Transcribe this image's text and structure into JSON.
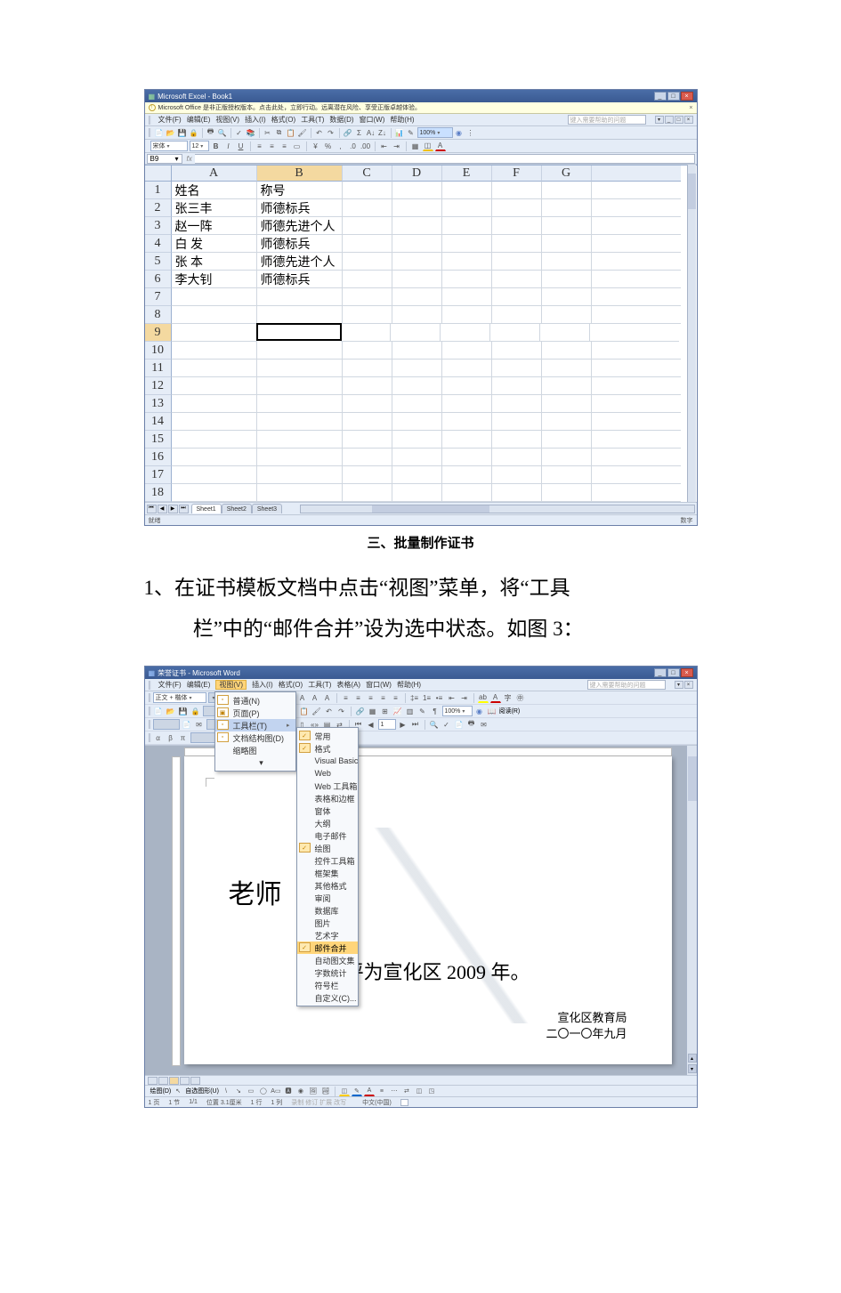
{
  "excel": {
    "title": "Microsoft Excel - Book1",
    "infobar": "Microsoft Office 是非正版授权版本。点击此处，立即行动。远离潜在风险、享受正版卓越体验。",
    "menus": [
      "文件(F)",
      "编辑(E)",
      "视图(V)",
      "插入(I)",
      "格式(O)",
      "工具(T)",
      "数据(D)",
      "窗口(W)",
      "帮助(H)"
    ],
    "help_placeholder": "键入需要帮助的问题",
    "font_name": "宋体",
    "font_size": "12",
    "namebox": "B9",
    "columns": [
      "A",
      "B",
      "C",
      "D",
      "E",
      "F",
      "G"
    ],
    "rows": [
      "1",
      "2",
      "3",
      "4",
      "5",
      "6",
      "7",
      "8",
      "9",
      "10",
      "11",
      "12",
      "13",
      "14",
      "15",
      "16",
      "17",
      "18"
    ],
    "data": [
      [
        "姓名",
        "称号",
        "",
        "",
        "",
        "",
        "",
        ""
      ],
      [
        "张三丰",
        "师德标兵",
        "",
        "",
        "",
        "",
        "",
        ""
      ],
      [
        "赵一阵",
        "师德先进个人",
        "",
        "",
        "",
        "",
        "",
        ""
      ],
      [
        "白  发",
        "师德标兵",
        "",
        "",
        "",
        "",
        "",
        ""
      ],
      [
        "张  本",
        "师德先进个人",
        "",
        "",
        "",
        "",
        "",
        ""
      ],
      [
        "李大钊",
        "师德标兵",
        "",
        "",
        "",
        "",
        "",
        ""
      ],
      [
        "",
        "",
        "",
        "",
        "",
        "",
        "",
        ""
      ],
      [
        "",
        "",
        "",
        "",
        "",
        "",
        "",
        ""
      ],
      [
        "",
        "",
        "",
        "",
        "",
        "",
        "",
        ""
      ],
      [
        "",
        "",
        "",
        "",
        "",
        "",
        "",
        ""
      ],
      [
        "",
        "",
        "",
        "",
        "",
        "",
        "",
        ""
      ],
      [
        "",
        "",
        "",
        "",
        "",
        "",
        "",
        ""
      ],
      [
        "",
        "",
        "",
        "",
        "",
        "",
        "",
        ""
      ],
      [
        "",
        "",
        "",
        "",
        "",
        "",
        "",
        ""
      ],
      [
        "",
        "",
        "",
        "",
        "",
        "",
        "",
        ""
      ],
      [
        "",
        "",
        "",
        "",
        "",
        "",
        "",
        ""
      ],
      [
        "",
        "",
        "",
        "",
        "",
        "",
        "",
        ""
      ],
      [
        "",
        "",
        "",
        "",
        "",
        "",
        "",
        ""
      ]
    ],
    "selected_cell": "B9",
    "tabs": [
      "Sheet1",
      "Sheet2",
      "Sheet3"
    ],
    "status_left": "就绪",
    "status_right": "数字"
  },
  "caption": "三、批量制作证书",
  "body": {
    "num": "1、",
    "line1": "在证书模板文档中点击“视图”菜单，将“工具",
    "line2": "栏”中的“邮件合并”设为选中状态。如图 3："
  },
  "word": {
    "title": " 荣誉证书  - Microsoft Word",
    "menus": [
      "文件(F)",
      "编辑(E)",
      "视图(V)",
      "插入(I)",
      "格式(O)",
      "工具(T)",
      "表格(A)",
      "窗口(W)",
      "帮助(H)"
    ],
    "open_menu": "视图(V)",
    "help_placeholder": "键入需要帮助的问题",
    "style_combo": "正文 + 楷体",
    "zoom": "100%",
    "submenu1": [
      {
        "label": "普通(N)",
        "icon": true
      },
      {
        "label": "页面(P)",
        "icon": true,
        "hl": true
      },
      {
        "label": "工具栏(T)",
        "icon": true,
        "arrow": true,
        "open": true
      },
      {
        "label": "文档结构图(D)",
        "icon": true
      },
      {
        "label": "缩略图"
      }
    ],
    "submenu_more": "▾",
    "submenu2": [
      {
        "label": "常用",
        "chk": true
      },
      {
        "label": "格式",
        "chk": true
      },
      {
        "label": "Visual Basic"
      },
      {
        "label": "Web"
      },
      {
        "label": "Web 工具箱"
      },
      {
        "label": "表格和边框"
      },
      {
        "label": "窗体"
      },
      {
        "label": "大纲"
      },
      {
        "label": "电子邮件"
      },
      {
        "label": "绘图",
        "chk": true
      },
      {
        "label": "控件工具箱"
      },
      {
        "label": "框架集"
      },
      {
        "label": "其他格式"
      },
      {
        "label": "审阅"
      },
      {
        "label": "数据库"
      },
      {
        "label": "图片"
      },
      {
        "label": "艺术字"
      },
      {
        "label": "邮件合并",
        "chk": true,
        "hl": true
      },
      {
        "label": "自动图文集"
      },
      {
        "label": "字数统计"
      },
      {
        "label": "符号栏"
      },
      {
        "label": "自定义(C)..."
      }
    ],
    "page": {
      "big1": "老师",
      "big2": "评为宣化区 2009 年。",
      "sig1": "宣化区教育局",
      "sig2": "二〇一〇年九月"
    },
    "draw_label": "绘图(D)",
    "shapes_label": "自选图形(U)",
    "status": {
      "page": "1 页",
      "sec": "1 节",
      "pages": "1/1",
      "pos": "位置 3.1厘米",
      "ln": "1 行",
      "col": "1 列",
      "modes": "录制 修订 扩展 改写",
      "lang": "中文(中国)"
    }
  }
}
